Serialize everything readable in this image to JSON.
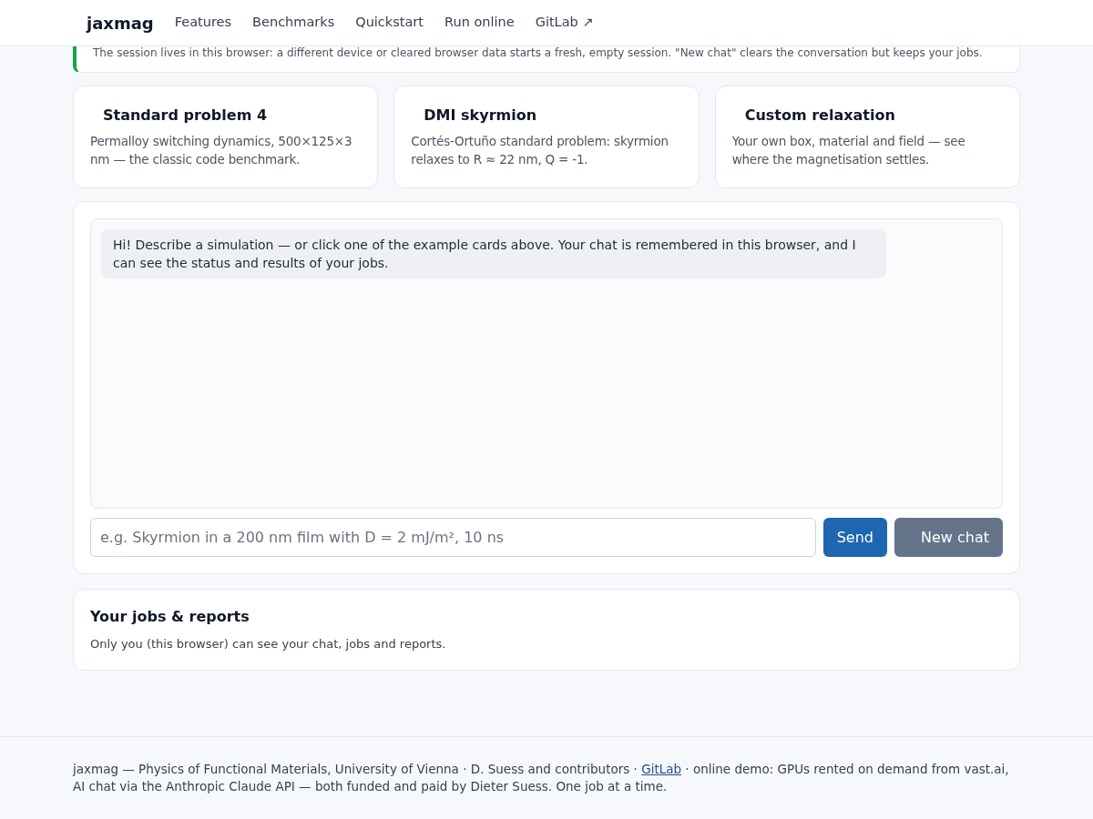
{
  "nav": {
    "brand": "jaxmag",
    "links": [
      "Features",
      "Benchmarks",
      "Quickstart",
      "Run online",
      "GitLab ↗"
    ]
  },
  "notice": {
    "text": "The session lives in this browser: a different device or cleared browser data starts a fresh, empty session. \"New chat\" clears the conversation but keeps your jobs."
  },
  "examples": [
    {
      "title": "Standard problem 4",
      "text": "Permalloy switching dynamics, 500×125×3 nm — the classic code benchmark."
    },
    {
      "title": "DMI skyrmion",
      "text": "Cortés-Ortuño standard problem: skyrmion relaxes to R ≈ 22 nm, Q = -1."
    },
    {
      "title": "Custom relaxation",
      "text": "Your own box, material and field — see where the magnetisation settles."
    }
  ],
  "chat": {
    "messages": [
      {
        "kind": "assistant",
        "text": "Hi! Describe a simulation — or click one of the example cards above. Your chat is remembered in this browser, and I can see the status and results of your jobs."
      }
    ],
    "placeholder": "e.g. Skyrmion in a 200 nm film with D = 2 mJ/m², 10 ns",
    "send": "Send",
    "new_chat": "New chat"
  },
  "jobs": {
    "title": "Your jobs & reports",
    "note": "Only you (this browser) can see your chat, jobs and reports."
  },
  "footer": {
    "before": "jaxmag — Physics of Functional Materials, University of Vienna · D. Suess and contributors · ",
    "link": "GitLab",
    "after": " · online demo: GPUs rented on demand from vast.ai, AI chat via the Anthropic Claude API — both funded and paid by Dieter Suess. One job at a time."
  }
}
